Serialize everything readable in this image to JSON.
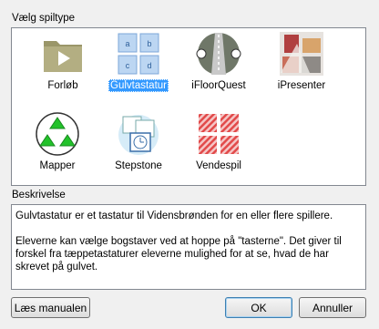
{
  "dialog": {
    "group_label": "Vælg spiltype",
    "description_label": "Beskrivelse",
    "description_paragraphs": [
      "Gulvtastatur er et tastatur til Vidensbrønden for en eller flere spillere.",
      "Eleverne kan vælge bogstaver ved at hoppe på \"tasterne\". Det giver til forskel fra tæppetastaturer eleverne mulighed for at se, hvad de har skrevet på gulvet."
    ]
  },
  "game_types": [
    {
      "label": "Forløb",
      "icon": "folder-play-icon",
      "selected": false
    },
    {
      "label": "Gulvtastatur",
      "icon": "keyboard-grid-icon",
      "selected": true,
      "keys": [
        "a",
        "b",
        "c",
        "d"
      ]
    },
    {
      "label": "iFloorQuest",
      "icon": "quest-icon",
      "selected": false
    },
    {
      "label": "iPresenter",
      "icon": "presenter-icon",
      "selected": false
    },
    {
      "label": "Mapper",
      "icon": "triangles-icon",
      "selected": false
    },
    {
      "label": "Stepstone",
      "icon": "stepstone-icon",
      "selected": false
    },
    {
      "label": "Vendespil",
      "icon": "memory-cards-icon",
      "selected": false
    }
  ],
  "buttons": {
    "manual": "Læs manualen",
    "ok": "OK",
    "cancel": "Annuller"
  },
  "colors": {
    "selection": "#3399ff",
    "key_tile": "#bcd6f2",
    "triangle": "#22c22a",
    "memory_card": "#e24a4a"
  }
}
